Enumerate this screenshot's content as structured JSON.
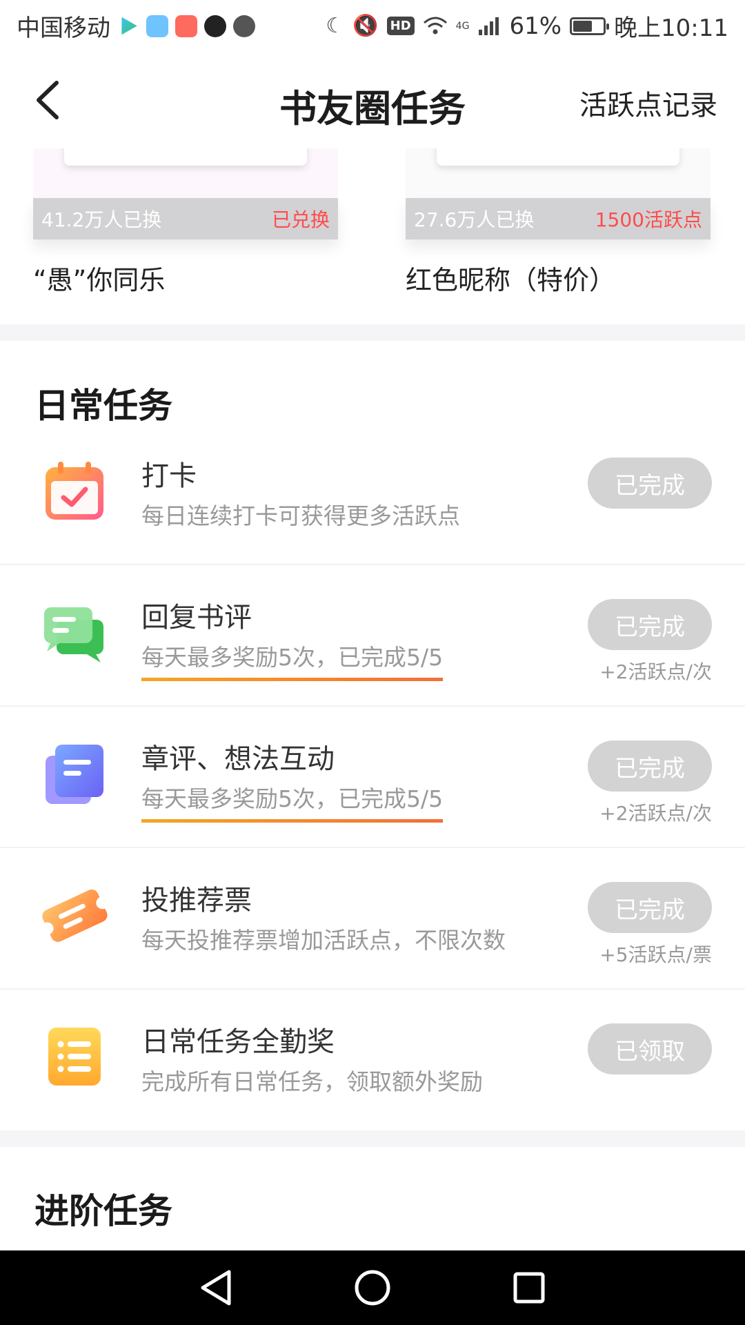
{
  "status_bar": {
    "carrier": "中国移动",
    "battery_percent": "61%",
    "battery_level": 0.61,
    "time": "晚上10:11",
    "network": "4G"
  },
  "header": {
    "title": "书友圈任务",
    "record_link": "活跃点记录"
  },
  "rewards": [
    {
      "exchanged": "41.2万人已换",
      "status": "已兑换",
      "name": "“愚”你同乐"
    },
    {
      "exchanged": "27.6万人已换",
      "status": "1500活跃点",
      "name": "红色昵称（特价）"
    }
  ],
  "daily": {
    "title": "日常任务",
    "tasks": [
      {
        "name": "打卡",
        "desc": "每日连续打卡可获得更多活跃点",
        "button": "已完成",
        "reward": ""
      },
      {
        "name": "回复书评",
        "desc": "每天最多奖励5次，已完成5/5",
        "button": "已完成",
        "reward": "+2活跃点/次"
      },
      {
        "name": "章评、想法互动",
        "desc": "每天最多奖励5次，已完成5/5",
        "button": "已完成",
        "reward": "+2活跃点/次"
      },
      {
        "name": "投推荐票",
        "desc": "每天投推荐票增加活跃点，不限次数",
        "button": "已完成",
        "reward": "+5活跃点/票"
      },
      {
        "name": "日常任务全勤奖",
        "desc": "完成所有日常任务，领取额外奖励",
        "button": "已领取",
        "reward": ""
      }
    ]
  },
  "advanced": {
    "title": "进阶任务"
  },
  "icons": {
    "checkin": "calendar-check-icon",
    "reply": "chat-bubbles-icon",
    "chapter": "document-stack-icon",
    "vote": "ticket-icon",
    "attendance": "list-icon"
  }
}
